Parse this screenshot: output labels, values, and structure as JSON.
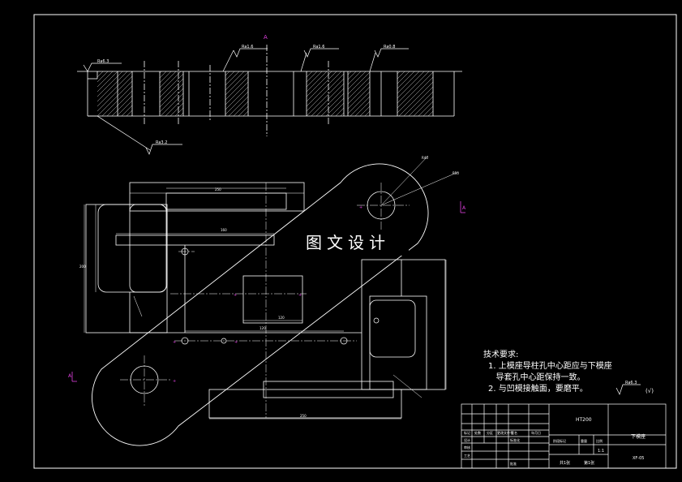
{
  "watermark": "图文设计",
  "tech_requirements": {
    "title": "技术要求:",
    "items": [
      "1. 上模座导柱孔中心距应与下模座",
      "   导套孔中心距保持一致。",
      "2. 与凹模接触面，要磨平。"
    ]
  },
  "roughness_note": "Ra6.3",
  "roughness_note_suffix": "(√)",
  "surface_labels": {
    "top_left": "Ra6.3",
    "top_mid1": "Ra1.6",
    "top_mid2": "Ra1.6",
    "top_right": "Ra0.8",
    "bottom_left": "Ra3.2"
  },
  "section_labels": {
    "A_top": "A",
    "A_right": "A",
    "A_left": "A"
  },
  "title_block": {
    "material": "HT200",
    "part_name": "下模座",
    "drawing_no": "XF-05",
    "scale": "1:1",
    "sheet": "共1张",
    "sheet2": "第1张",
    "labels": {
      "mark": "标记",
      "count": "处数",
      "zone": "分区",
      "change_doc": "更改文件号",
      "signature": "签名",
      "date": "年月日",
      "design": "设计",
      "standardize": "标准化",
      "review": "审核",
      "process": "工艺",
      "approve": "批准",
      "stage_mark": "阶段标记",
      "weight": "重量",
      "ratio": "比例"
    }
  },
  "dimensions": {
    "top_width": "250",
    "mid_width": "160",
    "inner_width": "120",
    "bottom_width": "250",
    "hole_spacing": "120",
    "left_height": "200",
    "radius_top": "R50",
    "radius_label": "R40"
  }
}
